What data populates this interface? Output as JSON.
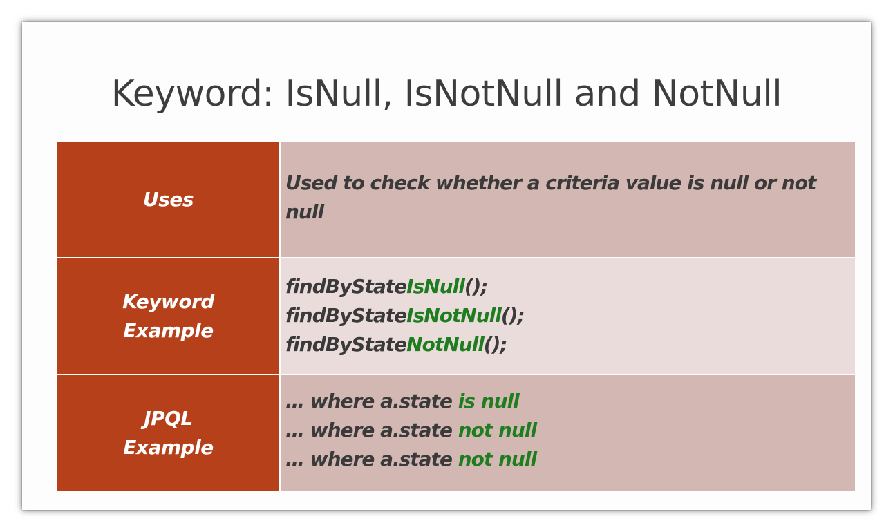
{
  "title": "Keyword: IsNull, IsNotNull and NotNull",
  "rows": {
    "uses": {
      "label": "Uses",
      "text": "Used to check whether a criteria value is null or not null"
    },
    "keyword_example": {
      "label_line1": "Keyword",
      "label_line2": "Example",
      "lines": [
        {
          "prefix": "findByState",
          "keyword": "IsNull",
          "suffix": "();"
        },
        {
          "prefix": "findByState",
          "keyword": "IsNotNull",
          "suffix": "();"
        },
        {
          "prefix": "findByState",
          "keyword": "NotNull",
          "suffix": "();"
        }
      ]
    },
    "jpql_example": {
      "label_line1": "JPQL",
      "label_line2": "Example",
      "lines": [
        {
          "prefix": "… where a.state ",
          "keyword": "is null"
        },
        {
          "prefix": "… where a.state ",
          "keyword": "not null"
        },
        {
          "prefix": "… where a.state ",
          "keyword": "not null"
        }
      ]
    }
  },
  "colors": {
    "label_background": "#b5401a",
    "row_dark": "#d3b7b3",
    "row_light": "#eadcda",
    "keyword_green": "#1e7d1e",
    "text_dark": "#3a3a3a"
  }
}
